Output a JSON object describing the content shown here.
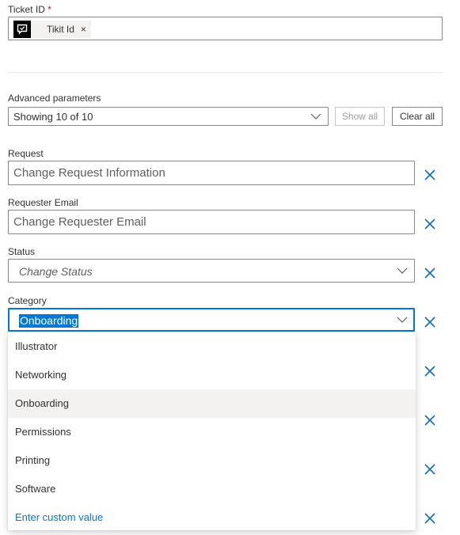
{
  "ticket": {
    "label": "Ticket ID",
    "required_mark": "*",
    "token_label": "Tikit Id",
    "token_remove": "×",
    "token_icon": "chat-square-icon"
  },
  "advanced": {
    "label": "Advanced parameters",
    "showing_text": "Showing 10 of 10",
    "show_all": "Show all",
    "clear_all": "Clear all"
  },
  "fields": {
    "request": {
      "label": "Request",
      "placeholder": "Change Request Information"
    },
    "requester_email": {
      "label": "Requester Email",
      "placeholder": "Change Requester Email"
    },
    "status": {
      "label": "Status",
      "placeholder": "Change Status"
    },
    "category": {
      "label": "Category",
      "value": "Onboarding"
    }
  },
  "category_options": [
    "Illustrator",
    "Networking",
    "Onboarding",
    "Permissions",
    "Printing",
    "Software"
  ],
  "custom_value": "Enter custom value",
  "colors": {
    "accent": "#0078d4",
    "remove_x": "#106ebe"
  }
}
